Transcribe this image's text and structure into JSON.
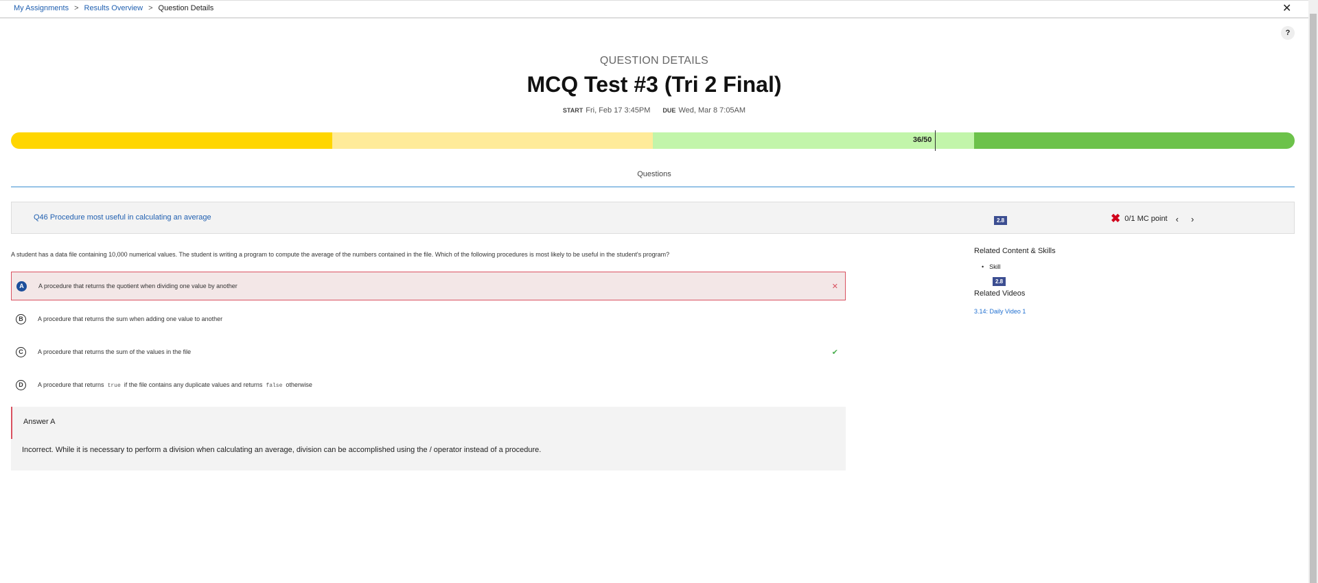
{
  "breadcrumb": [
    "My Assignments",
    "Results Overview",
    "Question Details"
  ],
  "header": {
    "subtitle": "QUESTION DETAILS",
    "title": "MCQ Test #3 (Tri 2 Final)",
    "start_label": "START",
    "start": "Fri, Feb 17 3:45PM",
    "due_label": "DUE",
    "due": "Wed, Mar 8 7:05AM"
  },
  "progress": {
    "score": "36/50",
    "fraction": 0.72,
    "colors": [
      "#ffd600",
      "#ffeb99",
      "#c2f5aa",
      "#6cc24a"
    ]
  },
  "tabs": {
    "questions": "Questions"
  },
  "question": {
    "title": "Q46 Procedure most useful in calculating an average",
    "skill_badge": "2.8",
    "points": "0/1 MC point",
    "stem": "A student has a data file containing 10,000 numerical values. The student is writing a program to compute the average of the numbers contained in the file. Which of the following procedures is most likely to be useful in the student's program?",
    "options": [
      {
        "letter": "A",
        "text": "A procedure that returns the quotient when dividing one value by another",
        "selected": true,
        "status": "incorrect"
      },
      {
        "letter": "B",
        "text": "A procedure that returns the sum when adding one value to another"
      },
      {
        "letter": "C",
        "text": "A procedure that returns the sum of the values in the file",
        "status": "correct"
      },
      {
        "letter": "D",
        "text_parts": [
          "A procedure that returns",
          "true",
          "if the file contains any duplicate values and returns",
          "false",
          "otherwise"
        ]
      }
    ]
  },
  "answer": {
    "label": "Answer A",
    "explanation": "Incorrect. While it is necessary to perform a division when calculating an average, division can be accomplished using the / operator instead of a procedure."
  },
  "side": {
    "related_title": "Related Content & Skills",
    "skill_label": "Skill",
    "skill_badge": "2.8",
    "videos_title": "Related Videos",
    "video": "3.14: Daily Video 1"
  },
  "icons": {
    "close": "close-icon",
    "help": "help-icon"
  }
}
